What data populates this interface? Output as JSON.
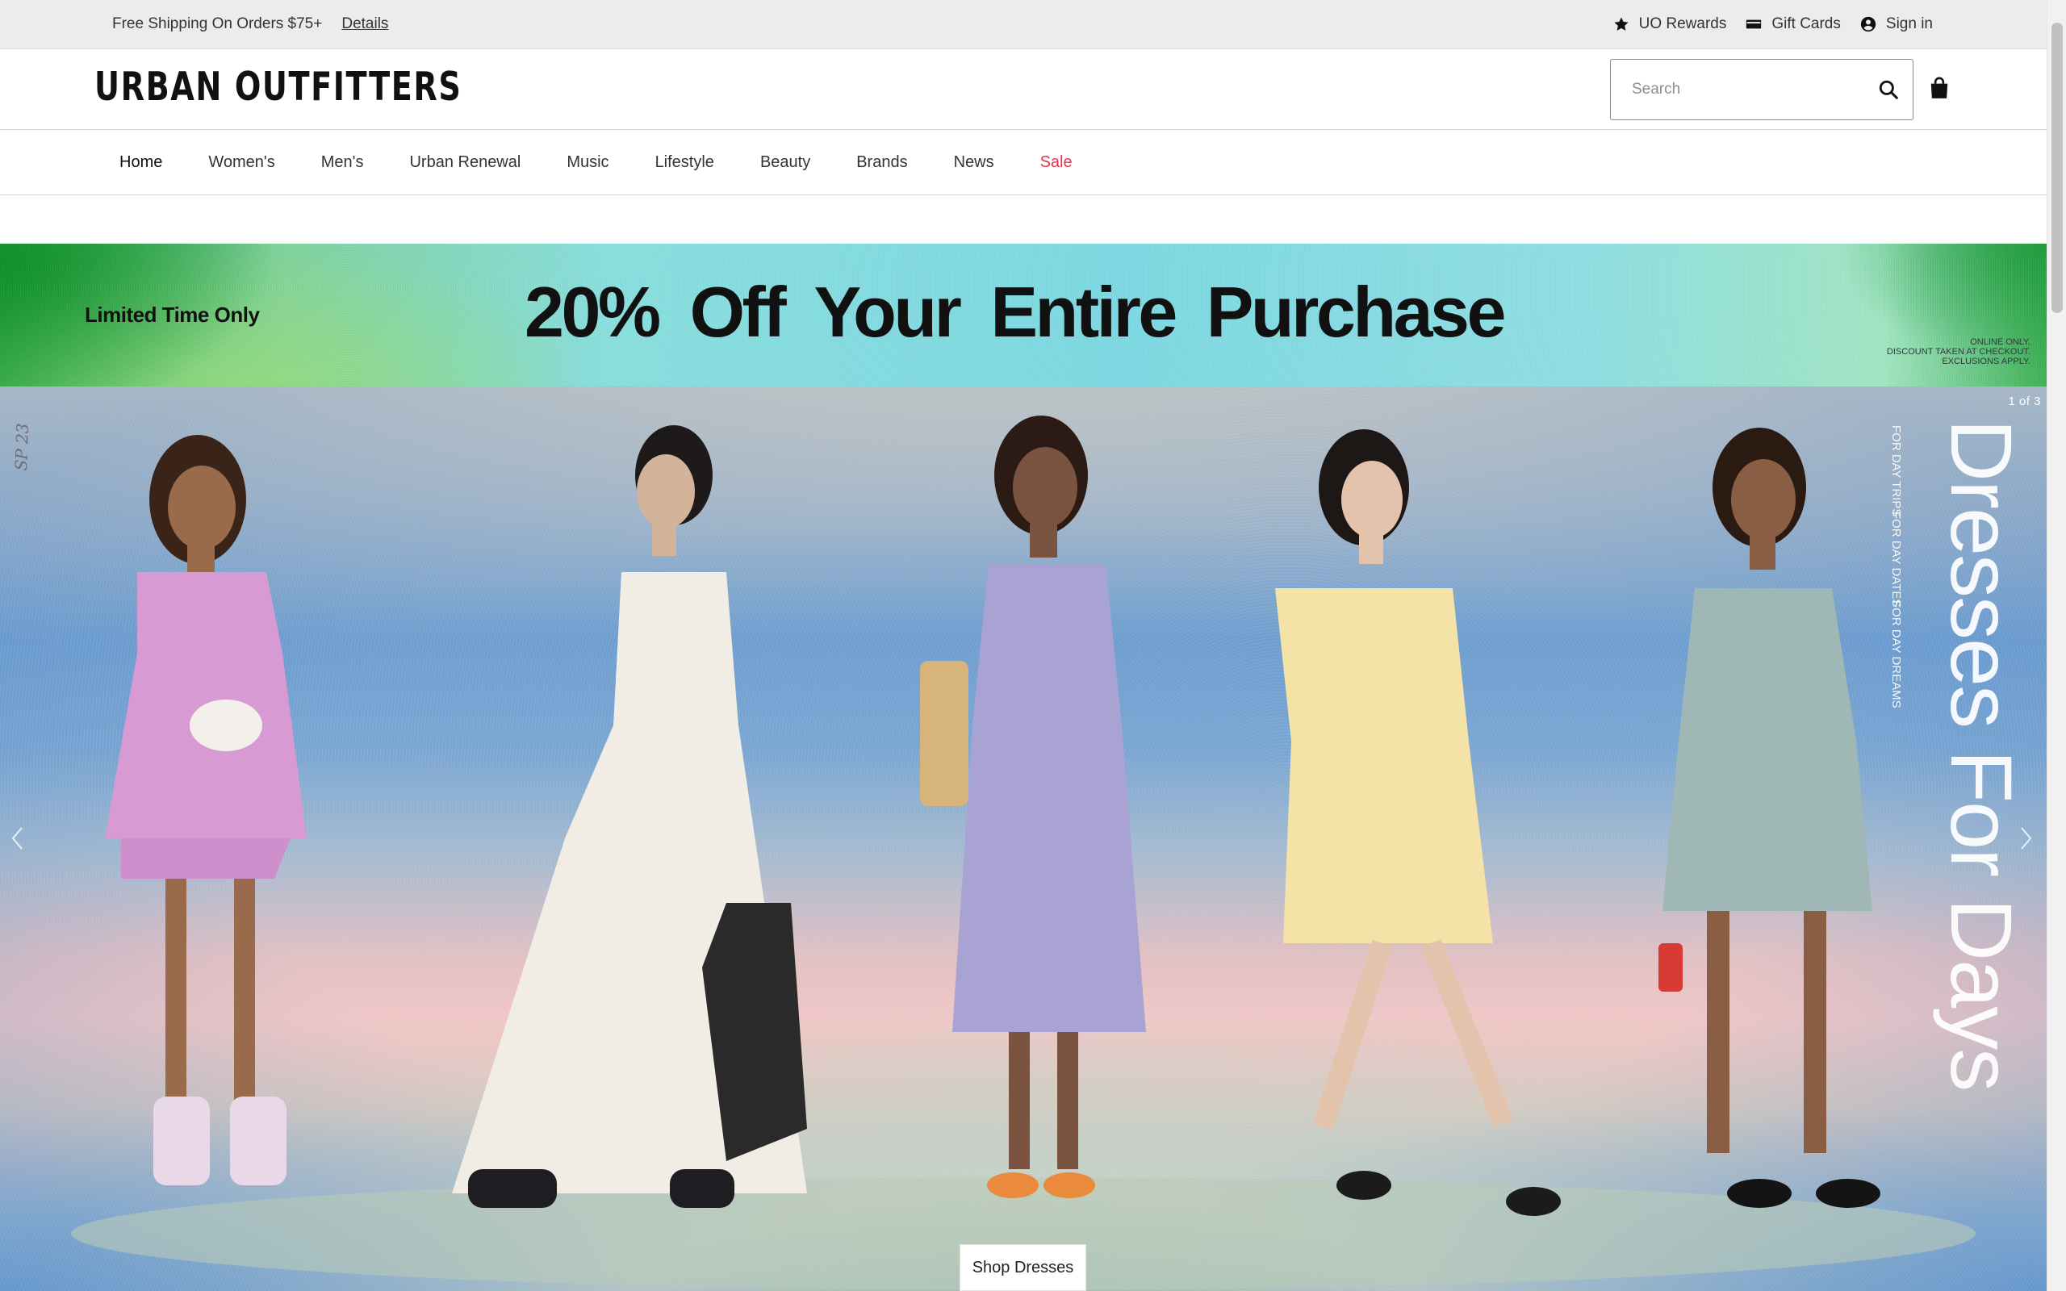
{
  "utility_bar": {
    "shipping_text": "Free Shipping On Orders $75+",
    "details_link": "Details",
    "rewards": "UO Rewards",
    "gift_cards": "Gift Cards",
    "sign_in": "Sign in"
  },
  "header": {
    "logo": "URBAN OUTFITTERS",
    "search_placeholder": "Search"
  },
  "nav": {
    "items": [
      "Home",
      "Women's",
      "Men's",
      "Urban Renewal",
      "Music",
      "Lifestyle",
      "Beauty",
      "Brands",
      "News",
      "Sale"
    ]
  },
  "promo": {
    "eyebrow": "Limited Time Only",
    "headline": "20% Off Your Entire Purchase",
    "fine_print": [
      "ONLINE ONLY.",
      "DISCOUNT TAKEN AT CHECKOUT.",
      "EXCLUSIONS APPLY."
    ]
  },
  "hero": {
    "slide_counter": "1 of 3",
    "title": "Dresses For Days",
    "tagline_lines": [
      "FOR DAY TRIPS",
      "FOR DAY DATES",
      "FOR DAY DREAMS"
    ],
    "scribble": "SP 23",
    "cta": "Shop Dresses"
  },
  "colors": {
    "sale": "#e8334a",
    "banner_teal": "#86dcdc",
    "banner_green": "#2aa043",
    "hero_blue": "#6e9ed0",
    "hero_pink": "#f0c6c6"
  },
  "icons": {
    "rewards": "star-icon",
    "gift_cards": "gift-card-icon",
    "sign_in": "user-circle-icon",
    "search": "search-icon",
    "bag": "shopping-bag-icon"
  }
}
